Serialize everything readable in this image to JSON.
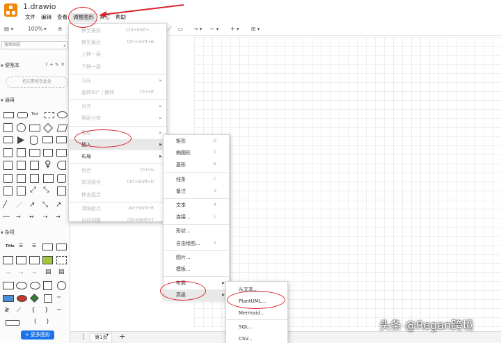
{
  "title": "1.drawio",
  "menubar": [
    "文件",
    "编辑",
    "查看",
    "调整图形",
    "其它",
    "帮助"
  ],
  "toolbar": {
    "zoom": "100%"
  },
  "left_panel": {
    "search_placeholder": "搜索图形",
    "scratchpad": "便笺本",
    "scratchpad_icons": "? + ✎ ✕",
    "drop_hint": "把元素拖至此处",
    "general": "通用",
    "misc": "杂项",
    "more_shapes": "+ 更多图形"
  },
  "arrange_menu": [
    {
      "label": "移至最前",
      "shortcut": "Ctrl+Shift+...",
      "disabled": true
    },
    {
      "label": "移至最后",
      "shortcut": "Ctrl+Shift+B",
      "disabled": true
    },
    {
      "label": "上移一层",
      "shortcut": "",
      "disabled": true
    },
    {
      "label": "下移一层",
      "shortcut": "",
      "disabled": true
    },
    {
      "label": "方向",
      "shortcut": "",
      "disabled": true,
      "submenu": true
    },
    {
      "label": "旋转90° / 翻转",
      "shortcut": "Ctrl+R",
      "disabled": true
    },
    {
      "label": "对齐",
      "shortcut": "",
      "disabled": true,
      "submenu": true
    },
    {
      "label": "等距分布",
      "shortcut": "",
      "disabled": true,
      "submenu": true
    },
    {
      "label": "导航",
      "shortcut": "",
      "disabled": true,
      "submenu": true
    },
    {
      "label": "插入",
      "shortcut": "",
      "disabled": false,
      "submenu": true
    },
    {
      "label": "布局",
      "shortcut": "",
      "disabled": false,
      "submenu": true
    },
    {
      "label": "组合",
      "shortcut": "Ctrl+G",
      "disabled": true
    },
    {
      "label": "取消组合",
      "shortcut": "Ctrl+Shift+U",
      "disabled": true
    },
    {
      "label": "移出组合",
      "shortcut": "",
      "disabled": true
    },
    {
      "label": "清除航点",
      "shortcut": "Alt+Shift+R",
      "disabled": true
    },
    {
      "label": "自动调整",
      "shortcut": "Ctrl+Shift+Y",
      "disabled": true
    }
  ],
  "insert_menu": [
    {
      "label": "矩形",
      "shortcut": "D"
    },
    {
      "label": "椭圆形",
      "shortcut": "F"
    },
    {
      "label": "菱形",
      "shortcut": "R"
    },
    {
      "label": "线条",
      "shortcut": "C"
    },
    {
      "label": "备注",
      "shortcut": "S"
    },
    {
      "label": "文本",
      "shortcut": "A"
    },
    {
      "label": "连接...",
      "shortcut": "L"
    },
    {
      "label": "形状...",
      "shortcut": ""
    },
    {
      "label": "自由绘图...",
      "shortcut": "X"
    },
    {
      "label": "图片...",
      "shortcut": ""
    },
    {
      "label": "模板...",
      "shortcut": ""
    },
    {
      "label": "布局",
      "shortcut": "",
      "submenu": true
    },
    {
      "label": "高级",
      "shortcut": "",
      "submenu": true
    }
  ],
  "advanced_menu": [
    "从文本...",
    "PlantUML...",
    "Mermaid...",
    "SQL...",
    "CSV..."
  ],
  "bottom": {
    "page_tab": "第1页"
  },
  "watermark": "头条 @Regan跨境",
  "colors": {
    "accent": "#1a73e8",
    "annotation": "#d8232a",
    "logo": "#f08705"
  }
}
